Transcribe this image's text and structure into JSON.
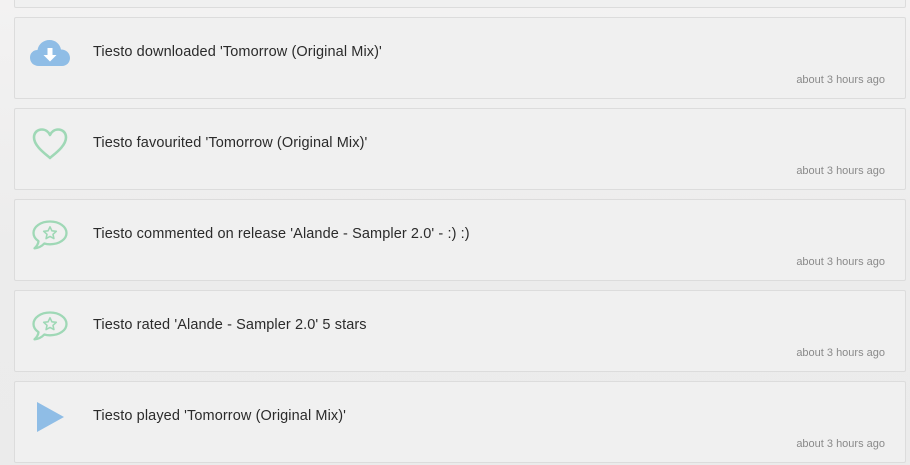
{
  "colors": {
    "download_icon": "#8fbde6",
    "heart_icon": "#9fd8b6",
    "comment_icon": "#9fd8b6",
    "play_icon": "#8fbde6"
  },
  "activities": [
    {
      "icon": "cloud-download-icon",
      "text": "Tiesto downloaded 'Tomorrow (Original Mix)'",
      "time": "about 3 hours ago"
    },
    {
      "icon": "heart-icon",
      "text": "Tiesto favourited 'Tomorrow (Original Mix)'",
      "time": "about 3 hours ago"
    },
    {
      "icon": "comment-star-icon",
      "text": "Tiesto commented on release 'Alande - Sampler 2.0' - :) :)",
      "time": "about 3 hours ago"
    },
    {
      "icon": "comment-star-icon",
      "text": "Tiesto rated 'Alande - Sampler 2.0' 5 stars",
      "time": "about 3 hours ago"
    },
    {
      "icon": "play-icon",
      "text": "Tiesto played 'Tomorrow (Original Mix)'",
      "time": "about 3 hours ago"
    }
  ]
}
